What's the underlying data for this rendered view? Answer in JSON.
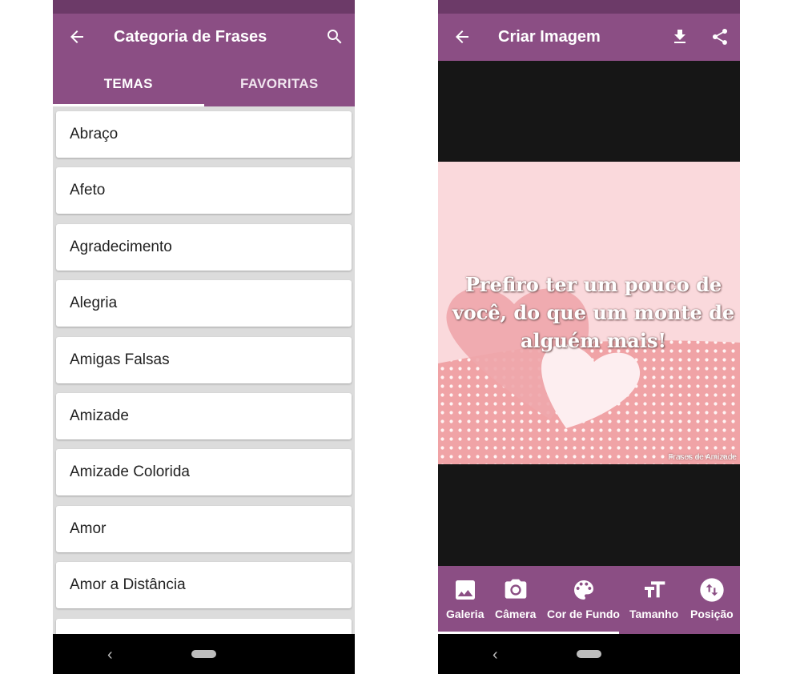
{
  "left_screen": {
    "title": "Categoria de Frases",
    "icons": {
      "back": "arrow-back-icon",
      "search": "search-icon"
    },
    "tabs": [
      {
        "label": "TEMAS",
        "selected": true
      },
      {
        "label": "FAVORITAS",
        "selected": false
      }
    ],
    "categories": [
      "Abraço",
      "Afeto",
      "Agradecimento",
      "Alegria",
      "Amigas Falsas",
      "Amizade",
      "Amizade Colorida",
      "Amor",
      "Amor a Distância"
    ]
  },
  "right_screen": {
    "title": "Criar Imagem",
    "icons": {
      "back": "arrow-back-icon",
      "download": "download-icon",
      "share": "share-icon"
    },
    "image": {
      "quote": "Prefiro ter um pouco de você, do que um monte de alguém mais!",
      "watermark": "Frases de Amizade"
    },
    "toolbar": [
      {
        "label": "Galeria",
        "icon": "image-icon"
      },
      {
        "label": "Câmera",
        "icon": "camera-icon"
      },
      {
        "label": "Cor de Fundo",
        "icon": "palette-icon"
      },
      {
        "label": "Tamanho",
        "icon": "text-size-icon"
      },
      {
        "label": "Posição",
        "icon": "swap-vertical-icon"
      }
    ]
  },
  "colors": {
    "primary": "#8b4e84",
    "primary_dark": "#6c3a68",
    "list_background": "#dcdcdc",
    "card": "#ffffff",
    "nav_bar": "#000000"
  }
}
